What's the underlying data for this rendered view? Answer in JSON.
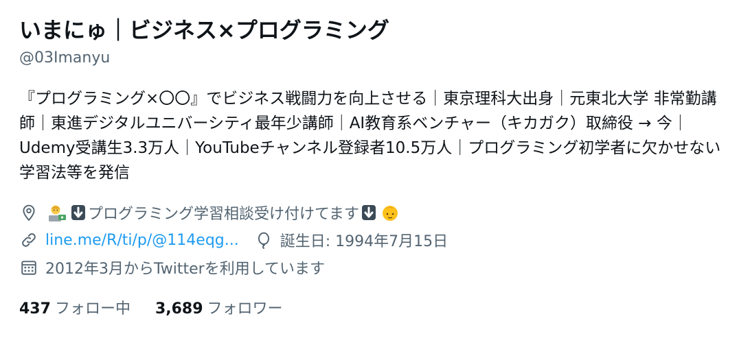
{
  "profile": {
    "display_name": "いまにゅ｜ビジネス×プログラミング",
    "handle": "@03Imanyu",
    "bio": "『プログラミング×〇〇』でビジネス戦闘力を向上させる｜東京理科大出身｜元東北大学 非常勤講師｜東進デジタルユニバーシティ最年少講師｜AI教育系ベンチャー（キカガク）取締役 → 今｜Udemy受講生3.3万人｜YouTubeチャンネル登録者10.5万人｜プログラミング初学者に欠かせない学習法等を発信",
    "location_text": "プログラミング学習相談受け付けてます",
    "website": "line.me/R/ti/p/@114eqg...",
    "birthday": "誕生日: 1994年7月15日",
    "joined": "2012年3月からTwitterを利用しています"
  },
  "stats": {
    "following_count": "437",
    "following_label": "フォロー中",
    "followers_count": "3,689",
    "followers_label": "フォロワー"
  },
  "icons": {
    "location": "location-pin-icon",
    "link": "link-icon",
    "birthday": "balloon-icon",
    "calendar": "calendar-icon"
  },
  "colors": {
    "text_primary": "#0f1419",
    "text_secondary": "#536471",
    "link": "#1d9bf0"
  }
}
